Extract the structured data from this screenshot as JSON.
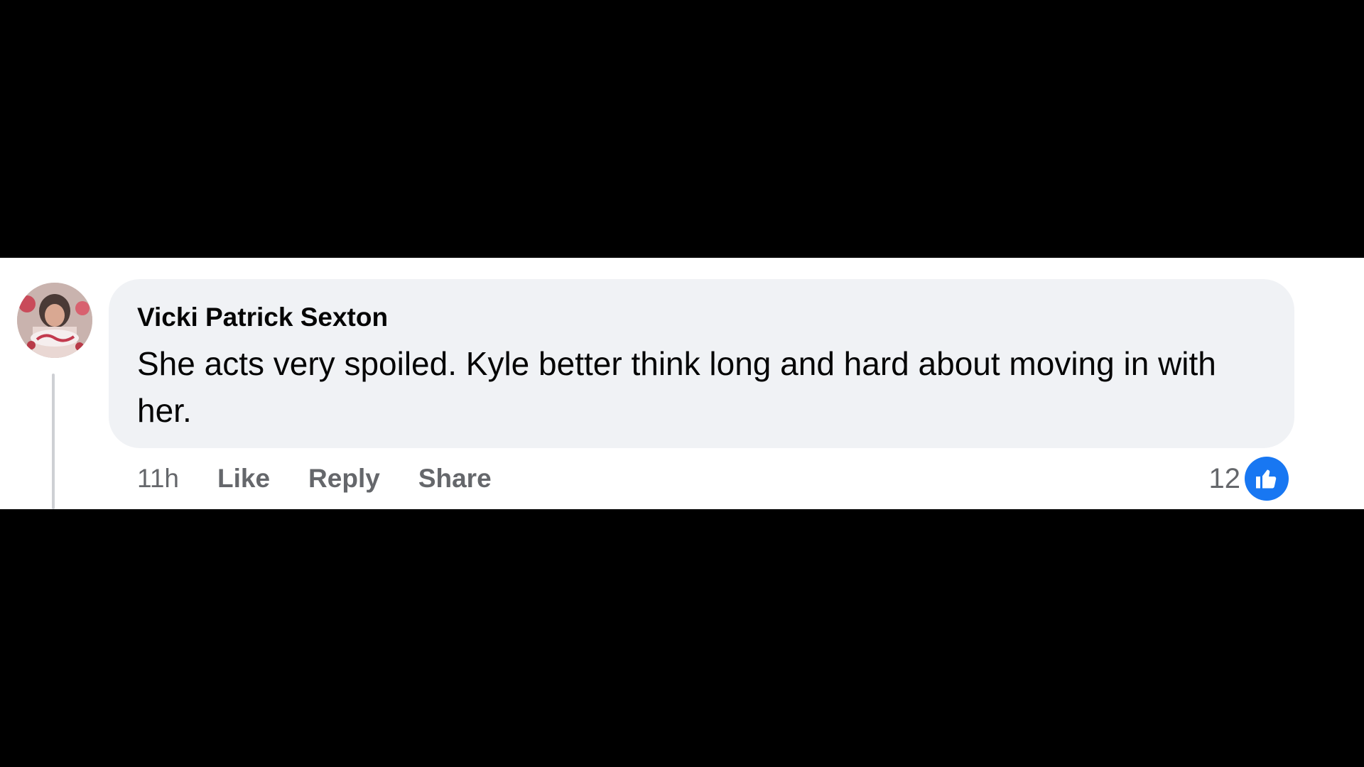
{
  "comment": {
    "author": "Vicki Patrick Sexton",
    "text": "She acts very spoiled. Kyle better think long and hard about moving in with her.",
    "avatar_icon": "profile-photo",
    "timestamp": "11h",
    "actions": {
      "like_label": "Like",
      "reply_label": "Reply",
      "share_label": "Share"
    },
    "reactions": {
      "count": "12",
      "icon": "thumbs-up-icon",
      "badge_color": "#1877f2"
    }
  },
  "colors": {
    "bubble": "#f0f2f5",
    "text": "#050505",
    "secondary_text": "#65676b",
    "background": "#ffffff",
    "letterbox": "#000000"
  }
}
